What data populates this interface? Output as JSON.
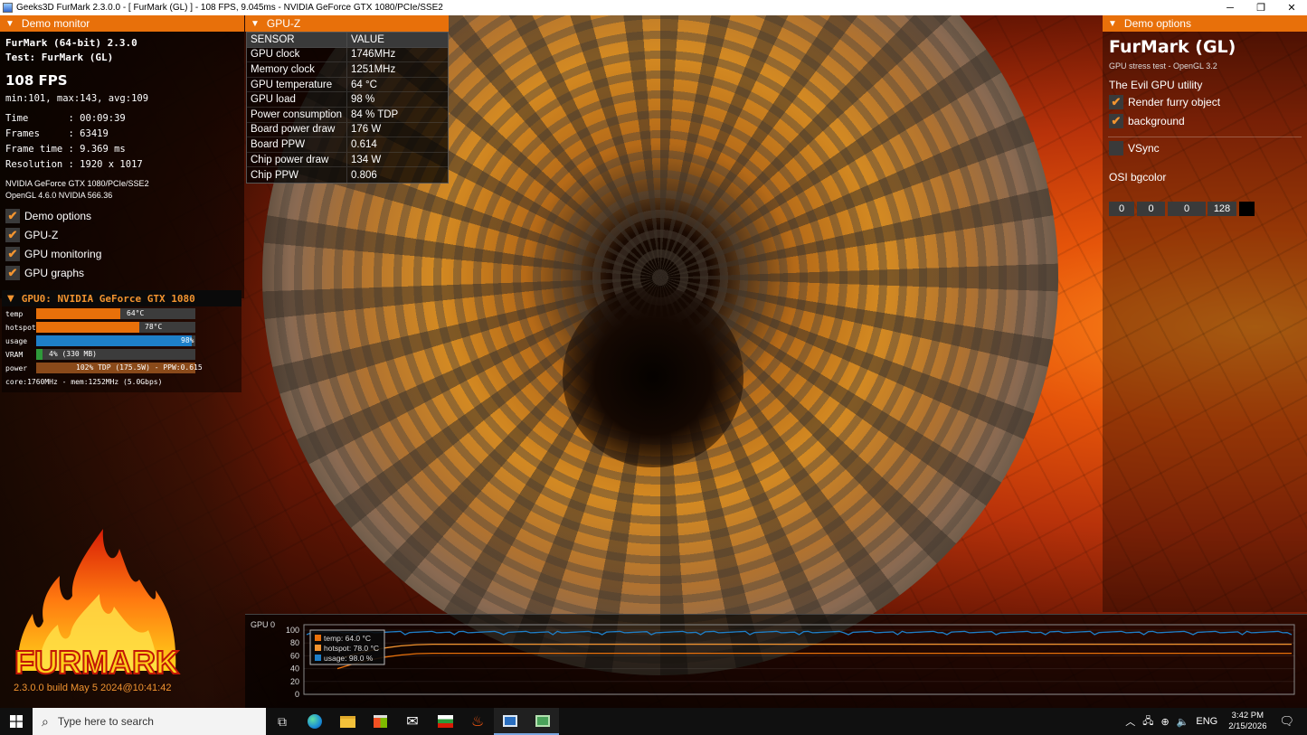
{
  "window": {
    "title": "Geeks3D FurMark 2.3.0.0 - [ FurMark (GL) ] - 108 FPS, 9.045ms - NVIDIA GeForce GTX 1080/PCIe/SSE2",
    "minimize": "─",
    "restore": "❐",
    "close": "✕"
  },
  "demo_monitor": {
    "header": "Demo monitor",
    "app_name": "FurMark (64-bit) 2.3.0",
    "test": "Test: FurMark (GL)",
    "fps": "108 FPS",
    "fps_stats": "min:101, max:143, avg:109",
    "time": "Time       : 00:09:39",
    "frames": "Frames     : 63419",
    "frame_time": "Frame time : 9.369 ms",
    "resolution": "Resolution : 1920 x 1017",
    "renderer": "NVIDIA GeForce GTX 1080/PCIe/SSE2",
    "opengl": "OpenGL 4.6.0 NVIDIA 566.36",
    "toggles": [
      {
        "label": "Demo options",
        "checked": true
      },
      {
        "label": "GPU-Z",
        "checked": true
      },
      {
        "label": "GPU monitoring",
        "checked": true
      },
      {
        "label": "GPU graphs",
        "checked": true
      }
    ],
    "checkmark": "✔"
  },
  "gpu0": {
    "header": "GPU0: NVIDIA GeForce GTX 1080",
    "bars": [
      {
        "label": "temp",
        "text": "64°C",
        "fraction": 0.53,
        "color": "#e8700a"
      },
      {
        "label": "hotspot",
        "text": "78°C",
        "fraction": 0.65,
        "color": "#e8700a"
      },
      {
        "label": "usage",
        "text": "98%",
        "fraction": 0.98,
        "color": "#1e7fc8"
      },
      {
        "label": "VRAM",
        "text": "4% (330 MB)",
        "fraction": 0.04,
        "color": "#2e9a3a"
      },
      {
        "label": "power",
        "text": "102% TDP (175.5W) - PPW:0.615",
        "fraction": 1.0,
        "color": "#8a4a1a"
      }
    ],
    "clocks": "core:1760MHz - mem:1252MHz (5.0Gbps)"
  },
  "logo": {
    "text": "FURMARK"
  },
  "build": "2.3.0.0 build May  5 2024@10:41:42",
  "gpuz": {
    "header": "GPU-Z",
    "col_sensor": "SENSOR",
    "col_value": "VALUE",
    "rows": [
      {
        "sensor": "GPU clock",
        "value": "1746MHz"
      },
      {
        "sensor": "Memory clock",
        "value": "1251MHz"
      },
      {
        "sensor": "GPU temperature",
        "value": "64 °C"
      },
      {
        "sensor": "GPU load",
        "value": "98 %"
      },
      {
        "sensor": "Power consumption",
        "value": "84 % TDP"
      },
      {
        "sensor": "Board power draw",
        "value": "176 W"
      },
      {
        "sensor": "Board PPW",
        "value": "0.614"
      },
      {
        "sensor": "Chip power draw",
        "value": "134 W"
      },
      {
        "sensor": "Chip PPW",
        "value": "0.806"
      }
    ]
  },
  "demo_options": {
    "header": "Demo options",
    "title": "FurMark (GL)",
    "subtitle": "GPU stress test - OpenGL 3.2",
    "tagline": "The Evil GPU utility",
    "options": [
      {
        "label": "Render furry object",
        "checked": true
      },
      {
        "label": "background",
        "checked": true
      }
    ],
    "vsync": {
      "label": "VSync",
      "checked": false
    },
    "bgcolor_label": "OSI bgcolor",
    "bgcolor_values": [
      "0",
      "0",
      "0",
      "128"
    ],
    "bgcolor_swatch": "#000000"
  },
  "graph": {
    "title": "GPU 0",
    "yticks": [
      "100",
      "80",
      "60",
      "40",
      "20",
      "0"
    ],
    "legend": [
      {
        "label": "temp: 64.0 °C",
        "color": "#e8700a"
      },
      {
        "label": "hotspot: 78.0 °C",
        "color": "#f29430"
      },
      {
        "label": "usage: 98.0 %",
        "color": "#1e7fc8"
      }
    ],
    "series_levels": {
      "temp": 64,
      "hotspot": 78,
      "usage": 98
    }
  },
  "taskbar": {
    "search_placeholder": "Type here to search",
    "lang": "ENG",
    "time": "3:42 PM",
    "date": "2/15/2026"
  }
}
